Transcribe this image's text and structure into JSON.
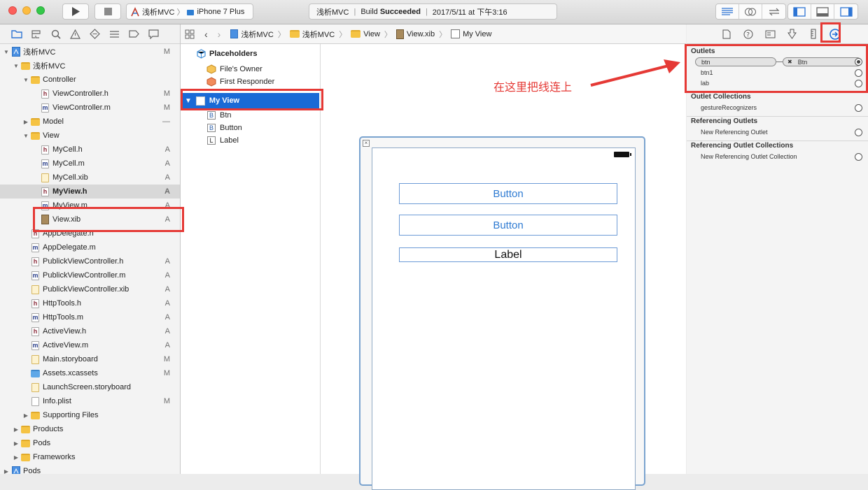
{
  "toolbar": {
    "scheme_project": "浅析MVC",
    "scheme_device": "iPhone 7 Plus",
    "status_project": "浅析MVC",
    "status_build_prefix": "Build",
    "status_build_result": "Succeeded",
    "status_time": "2017/5/11 at 下午3:16"
  },
  "navigator": {
    "items": [
      {
        "label": "浅析MVC",
        "badge": "M"
      },
      {
        "label": "浅析MVC",
        "badge": ""
      },
      {
        "label": "Controller",
        "badge": ""
      },
      {
        "label": "ViewController.h",
        "badge": "M"
      },
      {
        "label": "ViewController.m",
        "badge": "M"
      },
      {
        "label": "Model",
        "badge": "—"
      },
      {
        "label": "View",
        "badge": ""
      },
      {
        "label": "MyCell.h",
        "badge": "A"
      },
      {
        "label": "MyCell.m",
        "badge": "A"
      },
      {
        "label": "MyCell.xib",
        "badge": "A"
      },
      {
        "label": "MyView.h",
        "badge": "A"
      },
      {
        "label": "MyView.m",
        "badge": "A"
      },
      {
        "label": "View.xib",
        "badge": "A"
      },
      {
        "label": "AppDelegate.h",
        "badge": ""
      },
      {
        "label": "AppDelegate.m",
        "badge": ""
      },
      {
        "label": "PublickViewController.h",
        "badge": "A"
      },
      {
        "label": "PublickViewController.m",
        "badge": "A"
      },
      {
        "label": "PublickViewController.xib",
        "badge": "A"
      },
      {
        "label": "HttpTools.h",
        "badge": "A"
      },
      {
        "label": "HttpTools.m",
        "badge": "A"
      },
      {
        "label": "ActiveView.h",
        "badge": "A"
      },
      {
        "label": "ActiveView.m",
        "badge": "A"
      },
      {
        "label": "Main.storyboard",
        "badge": "M"
      },
      {
        "label": "Assets.xcassets",
        "badge": "M"
      },
      {
        "label": "LaunchScreen.storyboard",
        "badge": ""
      },
      {
        "label": "Info.plist",
        "badge": "M"
      },
      {
        "label": "Supporting Files",
        "badge": ""
      },
      {
        "label": "Products",
        "badge": ""
      },
      {
        "label": "Pods",
        "badge": ""
      },
      {
        "label": "Frameworks",
        "badge": ""
      },
      {
        "label": "Pods",
        "badge": ""
      }
    ]
  },
  "jumpbar": {
    "crumbs": [
      "浅析MVC",
      "浅析MVC",
      "View",
      "View.xib",
      "My View"
    ]
  },
  "outline": {
    "placeholders": "Placeholders",
    "files_owner": "File's Owner",
    "first_responder": "First Responder",
    "my_view": "My View",
    "children": [
      {
        "letter": "B",
        "label": "Btn"
      },
      {
        "letter": "B",
        "label": "Button"
      },
      {
        "letter": "L",
        "label": "Label"
      }
    ]
  },
  "canvas": {
    "button1": "Button",
    "button2": "Button",
    "label": "Label"
  },
  "inspector": {
    "outlets_title": "Outlets",
    "outlets": [
      {
        "name": "btn",
        "target": "Btn"
      },
      {
        "name": "btn1"
      },
      {
        "name": "lab"
      }
    ],
    "outlet_collections_title": "Outlet Collections",
    "outlet_collections": [
      "gestureRecognizers"
    ],
    "ref_outlets_title": "Referencing Outlets",
    "ref_outlets_item": "New Referencing Outlet",
    "ref_collections_title": "Referencing Outlet Collections",
    "ref_collections_item": "New Referencing Outlet Collection"
  },
  "annotation": {
    "text": "在这里把线连上"
  },
  "colors": {
    "accent": "#1a6ad6",
    "annotation_red": "#e53935"
  }
}
